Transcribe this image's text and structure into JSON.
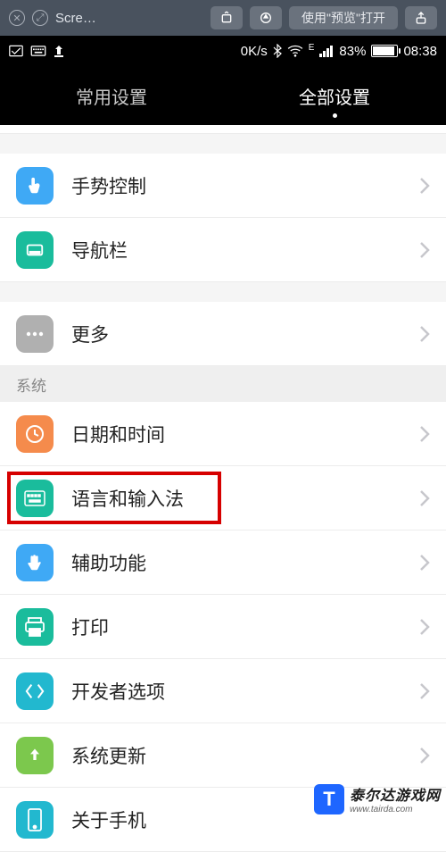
{
  "mac_toolbar": {
    "title": "Scre…",
    "open_with": "使用\"预览\"打开"
  },
  "status": {
    "speed": "0K/s",
    "signal": "E",
    "battery_pct": "83%",
    "time": "08:38"
  },
  "tabs": {
    "common": "常用设置",
    "all": "全部设置"
  },
  "rows": {
    "gesture": "手势控制",
    "navbar": "导航栏",
    "more": "更多",
    "section_system": "系统",
    "datetime": "日期和时间",
    "language": "语言和输入法",
    "accessibility": "辅助功能",
    "print": "打印",
    "developer": "开发者选项",
    "update": "系统更新",
    "about": "关于手机"
  },
  "watermark": {
    "badge": "T",
    "text": "泰尔达游戏网",
    "url": "www.tairda.com"
  }
}
